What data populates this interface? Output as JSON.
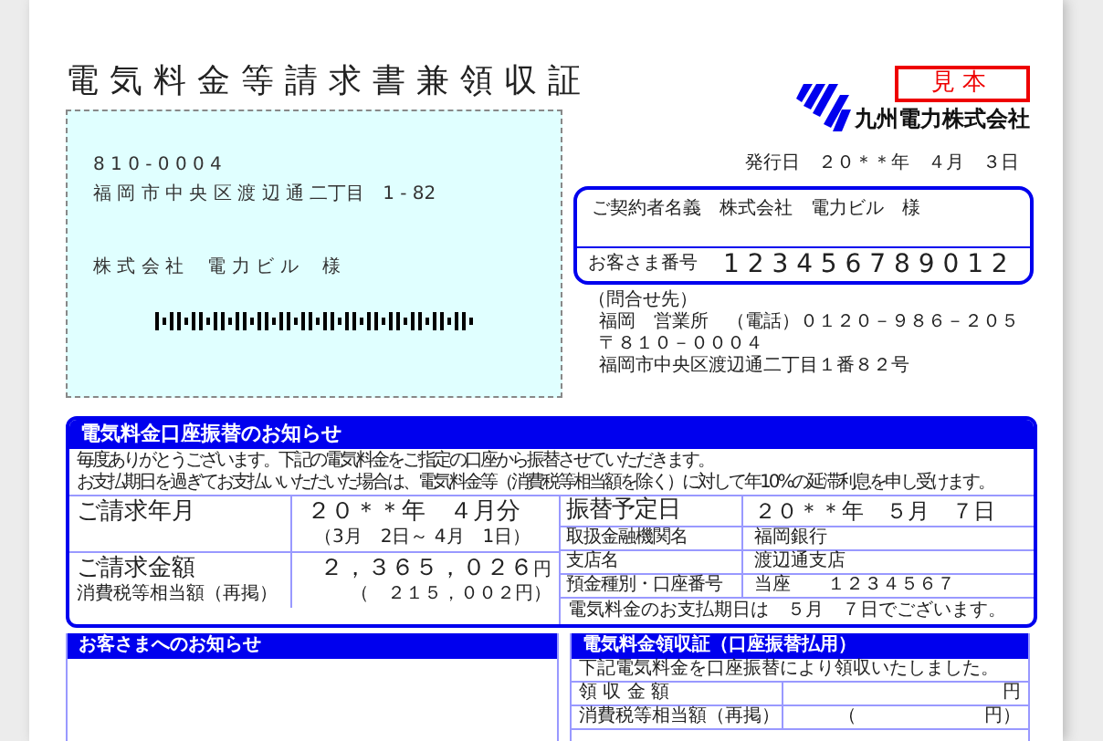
{
  "title": "電気料金等請求書兼領収証",
  "sample_stamp": "見本",
  "company_name": "九州電力株式会社",
  "issue_date": "発行日　２０＊＊年　４月　３日",
  "mailing": {
    "postal_code": "8 1 0 - 0 0 0 4",
    "address": "福 岡 市 中 央 区 渡 辺 通 二丁目　1 - 82",
    "recipient": "株 式 会 社　 電 力 ビ ル　 様"
  },
  "customer": {
    "contract_name_label": "ご契約者名義",
    "contract_name": "株式会社　電力ビル　様",
    "number_label": "お客さま番号",
    "number": "1 2 3 4 5 6 7 8 9 0 1 2"
  },
  "contact": {
    "heading": "（問合せ先）",
    "lines": [
      "福岡　営業所　（電話）０１２０－９８６－２０５",
      "〒８１０－０００４",
      "福岡市中央区渡辺通二丁目１番８２号"
    ]
  },
  "transfer_notice": {
    "title": "電気料金口座振替のお知らせ",
    "messages": [
      "毎度ありがとうございます。下記の電気料金をご指定の口座から振替させていただきます。",
      "お支払期日を過ぎてお支払いいただいた場合は、電気料金等（消費税等相当額を除く）に対して年10%の延滞利息を申し受けます。"
    ],
    "billing_month_label": "ご請求年月",
    "billing_month": "２０＊＊年　４月分",
    "billing_period": "（3月　2日～ 4月　1日）",
    "amount_label": "ご請求金額",
    "amount": "２，３６５，０２６",
    "amount_unit": "円",
    "tax_label": "消費税等相当額（再掲）",
    "tax_amount": "（　２１５，００２円）",
    "transfer_date_label": "振替予定日",
    "transfer_date": "２０＊＊年　５月　７日",
    "bank_rows": [
      {
        "label": "取扱金融機関名",
        "value": "福岡銀行"
      },
      {
        "label": "支店名",
        "value": "渡辺通支店"
      },
      {
        "label": "預金種別・口座番号",
        "value": "当座　　１２３４５６７"
      }
    ],
    "due_note": "電気料金のお支払期日は　５月　７日でございます。"
  },
  "customer_notice": {
    "title": "お客さまへのお知らせ"
  },
  "receipt": {
    "title": "電気料金領収証（口座振替払用）",
    "message": "下記電気料金を口座振替により領収いたしました。",
    "rows": [
      {
        "label": "領 収 金 額",
        "unit": "円"
      },
      {
        "label": "消費税等相当額（再掲）",
        "open": "（",
        "unit": "円）"
      }
    ]
  }
}
